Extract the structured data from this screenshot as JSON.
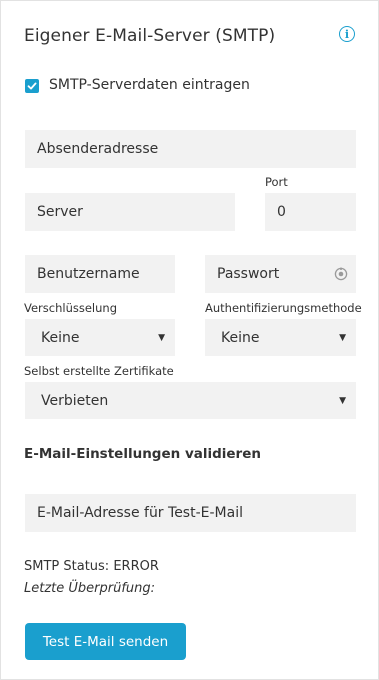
{
  "header": {
    "title": "Eigener E-Mail-Server (SMTP)",
    "info_icon": "info-circle-icon"
  },
  "smtp_checkbox": {
    "label": "SMTP-Serverdaten eintragen",
    "checked": true
  },
  "form": {
    "sender": {
      "placeholder": "Absenderadresse",
      "value": ""
    },
    "server": {
      "placeholder": "Server",
      "value": ""
    },
    "port": {
      "label": "Port",
      "value": "0"
    },
    "username": {
      "placeholder": "Benutzername",
      "value": ""
    },
    "password": {
      "placeholder": "Passwort",
      "value": "",
      "toggle_icon": "show-password-icon"
    },
    "encryption": {
      "label": "Verschlüsselung",
      "value": "Keine"
    },
    "auth_method": {
      "label": "Authentifizierungsmethode",
      "value": "Keine"
    },
    "self_signed": {
      "label": "Selbst erstellte Zertifikate",
      "value": "Verbieten"
    }
  },
  "validation": {
    "title": "E-Mail-Einstellungen validieren",
    "test_email": {
      "placeholder": "E-Mail-Adresse für Test-E-Mail",
      "value": ""
    },
    "status": "SMTP Status: ERROR",
    "last_check": "Letzte Überprüfung:",
    "button_label": "Test E-Mail senden"
  },
  "colors": {
    "accent": "#1a9fce",
    "field_bg": "#f2f2f2",
    "text": "#333333"
  }
}
